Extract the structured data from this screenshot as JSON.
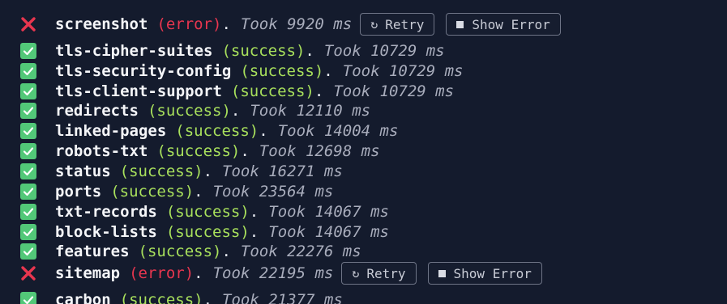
{
  "checks": [
    {
      "name": "screenshot",
      "status": "error",
      "status_text": "(error)",
      "period": ".",
      "took": "Took 9920 ms",
      "icon": "cross-icon"
    },
    {
      "name": "tls-cipher-suites",
      "status": "success",
      "status_text": "(success)",
      "period": ".",
      "took": "Took 10729 ms",
      "icon": "check-icon"
    },
    {
      "name": "tls-security-config",
      "status": "success",
      "status_text": "(success)",
      "period": ".",
      "took": "Took 10729 ms",
      "icon": "check-icon"
    },
    {
      "name": "tls-client-support",
      "status": "success",
      "status_text": "(success)",
      "period": ".",
      "took": "Took 10729 ms",
      "icon": "check-icon"
    },
    {
      "name": "redirects",
      "status": "success",
      "status_text": "(success)",
      "period": ".",
      "took": "Took 12110 ms",
      "icon": "check-icon"
    },
    {
      "name": "linked-pages",
      "status": "success",
      "status_text": "(success)",
      "period": ".",
      "took": "Took 14004 ms",
      "icon": "check-icon"
    },
    {
      "name": "robots-txt",
      "status": "success",
      "status_text": "(success)",
      "period": ".",
      "took": "Took 12698 ms",
      "icon": "check-icon"
    },
    {
      "name": "status",
      "status": "success",
      "status_text": "(success)",
      "period": ".",
      "took": "Took 16271 ms",
      "icon": "check-icon"
    },
    {
      "name": "ports",
      "status": "success",
      "status_text": "(success)",
      "period": ".",
      "took": "Took 23564 ms",
      "icon": "check-icon"
    },
    {
      "name": "txt-records",
      "status": "success",
      "status_text": "(success)",
      "period": ".",
      "took": "Took 14067 ms",
      "icon": "check-icon"
    },
    {
      "name": "block-lists",
      "status": "success",
      "status_text": "(success)",
      "period": ".",
      "took": "Took 14067 ms",
      "icon": "check-icon"
    },
    {
      "name": "features",
      "status": "success",
      "status_text": "(success)",
      "period": ".",
      "took": "Took 22276 ms",
      "icon": "check-icon"
    },
    {
      "name": "sitemap",
      "status": "error",
      "status_text": "(error)",
      "period": ".",
      "took": "Took 22195 ms",
      "icon": "cross-icon"
    },
    {
      "name": "carbon",
      "status": "success",
      "status_text": "(success)",
      "period": ".",
      "took": "Took 21377 ms",
      "icon": "check-icon"
    }
  ],
  "buttons": {
    "retry_label": "Retry",
    "retry_icon": "refresh-icon",
    "show_error_label": "Show Error",
    "show_error_icon": "stop-square-icon"
  },
  "colors": {
    "background": "#141b2d",
    "success_badge": "#52c878",
    "success_text": "#a8e05c",
    "error_text": "#e8364f",
    "error_icon": "#e8364f",
    "took_text": "#a9adbc"
  }
}
